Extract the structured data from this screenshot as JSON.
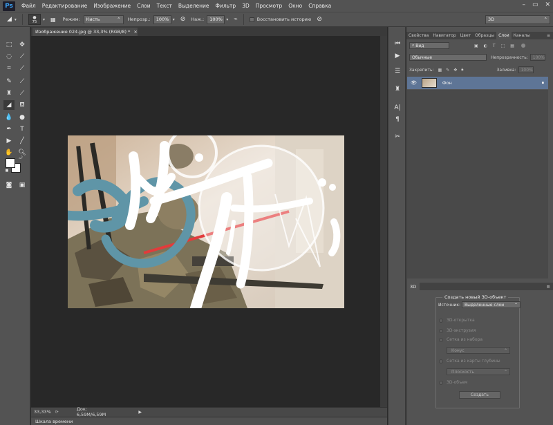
{
  "app": {
    "logo": "Ps"
  },
  "menu": [
    "Файл",
    "Редактирование",
    "Изображение",
    "Слои",
    "Текст",
    "Выделение",
    "Фильтр",
    "3D",
    "Просмотр",
    "Окно",
    "Справка"
  ],
  "window_controls": {
    "minimize": "–",
    "restore": "▭",
    "close": "✕"
  },
  "options": {
    "brush_size": "75",
    "mode_label": "Режим:",
    "mode_value": "Кисть",
    "opacity_label": "Непрозр.:",
    "opacity_value": "100%",
    "pressure_label": "Наж.:",
    "pressure_value": "100%",
    "restore_history_label": "Восстановить историю",
    "workspace": "3D"
  },
  "document": {
    "tab_title": "Изображение 024.jpg @ 33,3% (RGB/8) *",
    "tab_close": "×",
    "zoom": "33,33%",
    "doc_size": "Док: 6,59M/6,59M"
  },
  "timeline": {
    "label": "Шкала времени"
  },
  "layers_panel": {
    "tabs": [
      "Свойства",
      "Навигатор",
      "Цвет",
      "Образцы",
      "Слои",
      "Каналы"
    ],
    "active_tab": "Слои",
    "filter_kind": "Вид",
    "blend_mode": "Обычные",
    "opacity_label": "Непрозрачность:",
    "opacity_value": "100%",
    "lock_label": "Закрепить:",
    "fill_label": "Заливка:",
    "fill_value": "100%",
    "layers": [
      {
        "name": "Фон",
        "visible": true,
        "locked": true
      }
    ]
  },
  "panel_3d": {
    "tab": "3D",
    "group_title": "Создать новый 3D-объект",
    "source_label": "Источник:",
    "source_value": "Выделенные слои",
    "options": [
      "3D-открытка",
      "3D-экструзия",
      "Сетка из набора",
      "Сетка из карты глубины",
      "3D-объем"
    ],
    "preset_value": "Конус",
    "depth_value": "Плоскость",
    "create_button": "Создать"
  },
  "colors": {
    "accent_selection": "#5e7596",
    "panel_bg": "#535353",
    "canvas_bg": "#282828"
  }
}
